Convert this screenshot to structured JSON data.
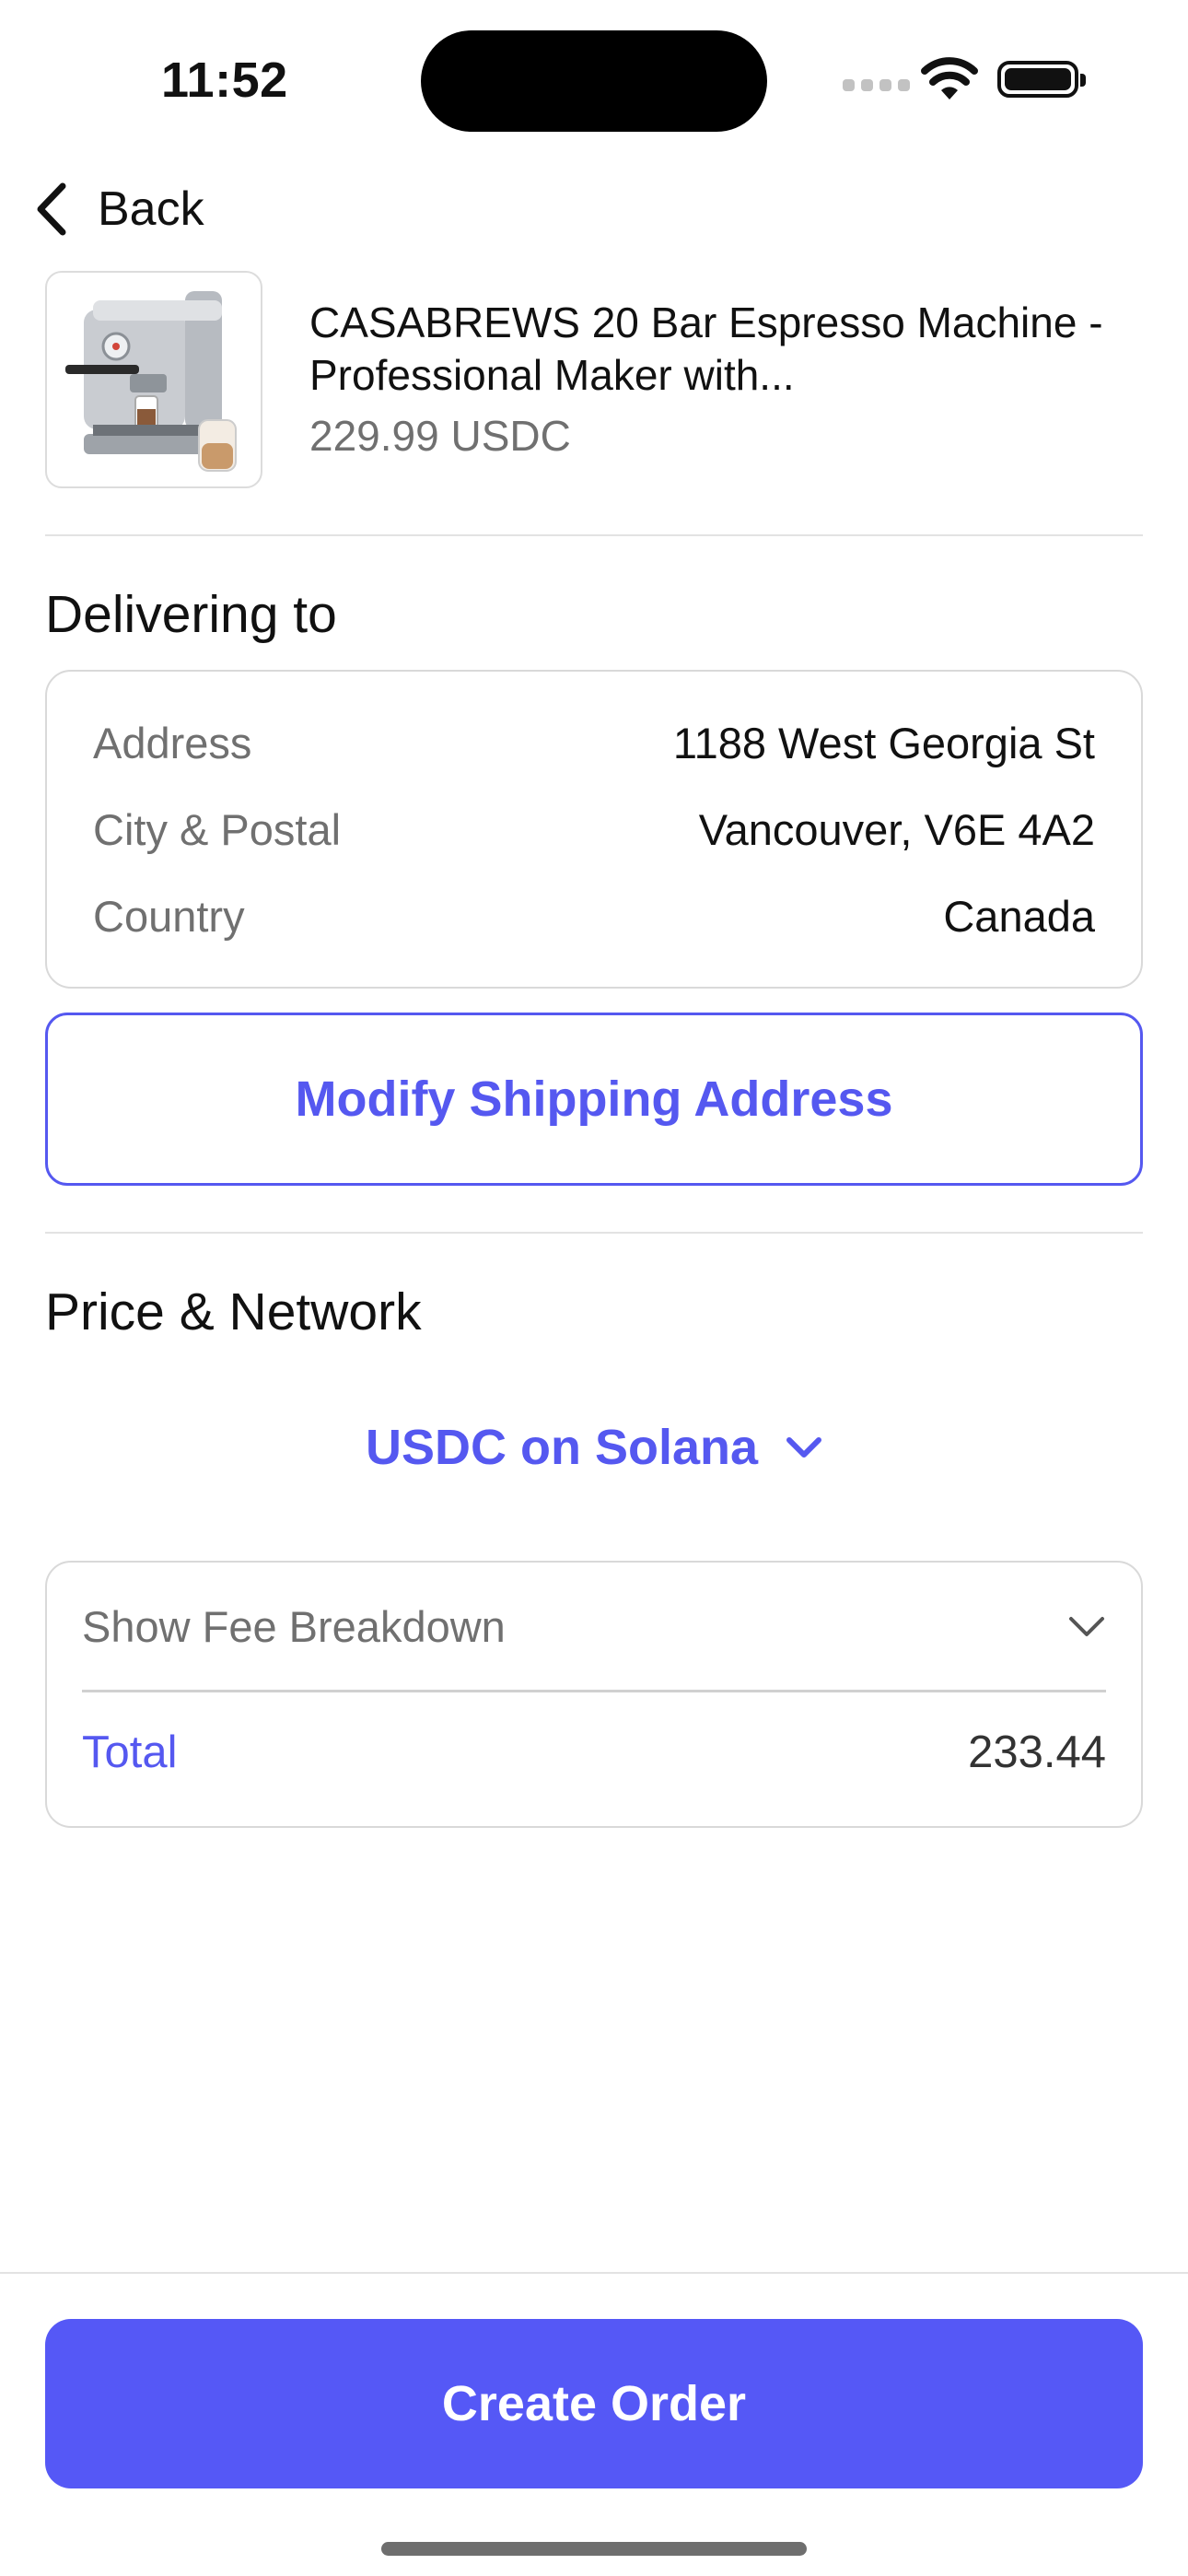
{
  "status_bar": {
    "time": "11:52"
  },
  "nav": {
    "back_label": "Back"
  },
  "product": {
    "title": "CASABREWS 20 Bar Espresso Machine - Professional Maker with...",
    "price": "229.99 USDC"
  },
  "delivery": {
    "section_title": "Delivering to",
    "rows": [
      {
        "key": "Address",
        "value": "1188 West Georgia St"
      },
      {
        "key": "City & Postal",
        "value": "Vancouver, V6E 4A2"
      },
      {
        "key": "Country",
        "value": "Canada"
      }
    ],
    "modify_button": "Modify Shipping Address"
  },
  "price_network": {
    "section_title": "Price & Network",
    "network_selector": "USDC on Solana",
    "fee_toggle_label": "Show Fee Breakdown",
    "total_label": "Total",
    "total_value": "233.44"
  },
  "footer": {
    "create_order_label": "Create Order"
  },
  "colors": {
    "accent": "#5558f0",
    "text": "#111111",
    "muted": "#707070",
    "border": "#d9d9d9"
  },
  "icons": [
    "chevron-left-icon",
    "wifi-icon",
    "battery-icon",
    "chevron-down-icon",
    "product-image"
  ]
}
